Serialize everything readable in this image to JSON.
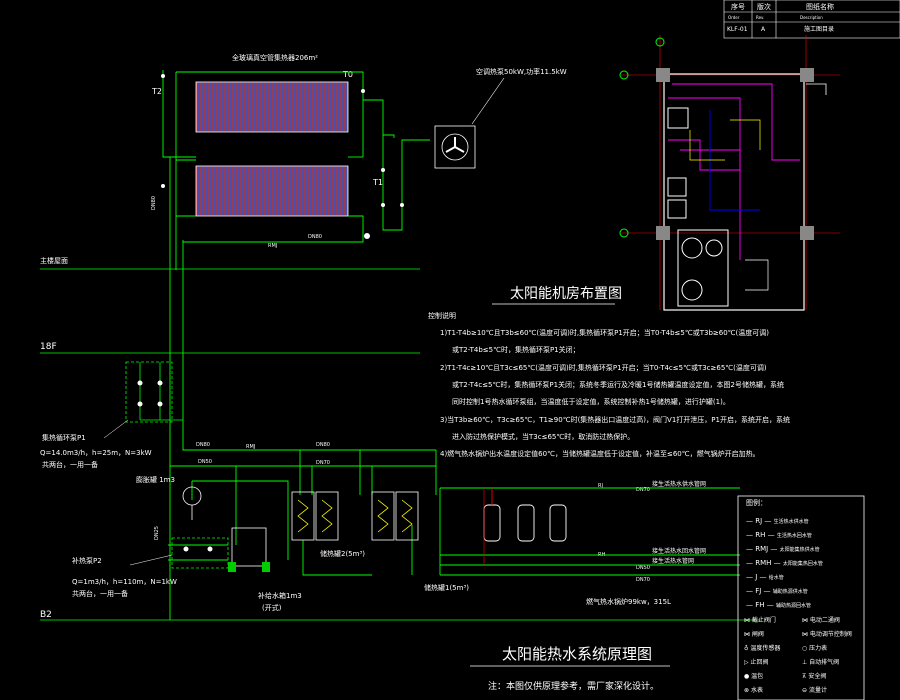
{
  "title_block": {
    "header": [
      "序号",
      "版次",
      "图纸名称"
    ],
    "header_sub": [
      "Order",
      "Rev.",
      "Description"
    ],
    "row": [
      "KLF-01",
      "A",
      "施工图目录"
    ]
  },
  "collector_label": "全玻璃真空管集热器206m²",
  "temps": {
    "t0": "T0",
    "t1": "T1",
    "t2": "T2",
    "t3": "T3",
    "t3b": "T3b"
  },
  "fan_label": "空调热泵50kW,功率11.5kW",
  "floor_labels": [
    "主楼屋面",
    "18F",
    "B2"
  ],
  "pipes": {
    "dn80": "DN80",
    "dn65": "DN65",
    "dn50": "DN50",
    "dn70": "DN70",
    "dn40": "DN40",
    "dn25": "DN25",
    "rmj": "RMJ",
    "rj": "RJ",
    "rh": "RH"
  },
  "pump1": {
    "title": "集热循环泵P1",
    "spec": "Q=14.0m3/h，h=25m，N=3kW",
    "note": "共两台，一用一备"
  },
  "pump2": {
    "title": "补热泵P2",
    "spec": "Q=1m3/h，h=110m，N=1kW",
    "note": "共两台，一用一备"
  },
  "expansion_tank": "膨胀罐 1m3",
  "tank2": "储热罐2(5m³)",
  "tank1": "储热罐1(5m³)",
  "water_tank": "补给水箱1m3",
  "water_tank_note": "(开式)",
  "heater_label": "燃气热水锅炉99kw，315L",
  "right_labels": [
    "接生活热水供水管网",
    "接生活热水回水管网",
    "接生活热水管网"
  ],
  "room_title": "太阳能机房布置图",
  "main_title": "太阳能热水系统原理图",
  "footnote": "注：本图仅供原理参考，需厂家深化设计。",
  "notes_title": "控制说明",
  "notes": [
    "1)T1-T4b≥10℃且T3b≤60℃(温度可调)时,集热循环泵P1开启；当T0-T4b≤5℃或T3b≥60℃(温度可调)",
    "或T2-T4b≤5℃时，集热循环泵P1关闭；",
    "2)T1-T4c≥10℃且T3c≤65℃(温度可调)时,集热循环泵P1开启；当T0-T4c≤5℃或T3c≥65℃(温度可调)",
    "或T2-T4c≤5℃时，集热循环泵P1关闭；系统冬季运行及冷暖1号储热罐温度设定值，本图2号储热罐，系统",
    "同时控制1号热水循环泵组，当温度低于设定值，系统控制补热1号储热罐，进行护罐(1)。",
    "3)当T3b≥60℃，T3c≥65℃，T1≥90℃时(集热器出口温度过高)，阀门V1打开泄压，P1开启，系统开启，系统",
    "进入防过热保护模式，当T3c≤65℃时，取消防过热保护。",
    "4)燃气热水锅炉出水温度设定值60℃，当储热罐温度低于设定值，补温至≤60℃，燃气锅炉开启加热。"
  ],
  "legend_title": "图例：",
  "legend": [
    {
      "code": "RJ",
      "text": "生活热水供水管"
    },
    {
      "code": "RH",
      "text": "生活热水回水管"
    },
    {
      "code": "RMJ",
      "text": "太阳能集热供水管"
    },
    {
      "code": "RMH",
      "text": "太阳能集热回水管"
    },
    {
      "code": "J",
      "text": "给水管"
    },
    {
      "code": "FJ",
      "text": "辅助热源供水管"
    },
    {
      "code": "FH",
      "text": "辅助热源回水管"
    }
  ],
  "legend_symbols": [
    {
      "a": "截止阀门",
      "b": "电动二通阀"
    },
    {
      "a": "闸阀",
      "b": "电动调节控制阀"
    },
    {
      "a": "温度传感器",
      "b": "压力表"
    },
    {
      "a": "止回阀",
      "b": "自动排气阀"
    },
    {
      "a": "温包",
      "b": "安全阀"
    },
    {
      "a": "水表",
      "b": "流量计"
    }
  ],
  "colors": {
    "green": "#00ff00",
    "white": "#ffffff",
    "red": "#ff0000",
    "magenta": "#ff00ff",
    "blue": "#0000ff",
    "grey": "#888888",
    "yellow": "#ffff00"
  }
}
